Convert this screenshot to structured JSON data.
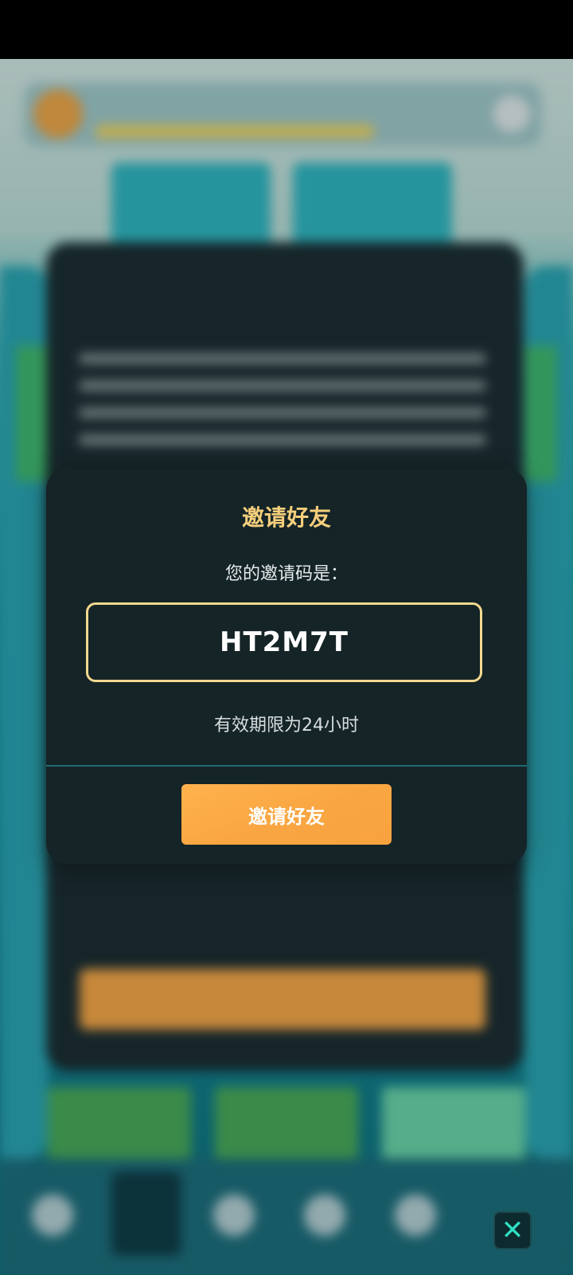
{
  "dialog": {
    "title": "邀请好友",
    "subtitle": "您的邀请码是：",
    "code": "HT2M7T",
    "validity": "有效期限为24小时",
    "button_label": "邀请好友",
    "accent_color": "#f6cf7c",
    "button_color": "#f9a642"
  },
  "close_button": {
    "icon": "close-icon",
    "glyph": "✕"
  }
}
